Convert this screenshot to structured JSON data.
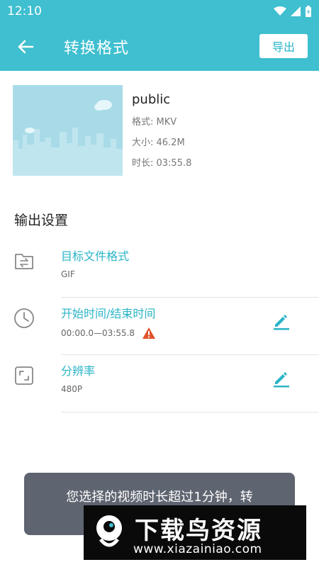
{
  "status_bar": {
    "time": "12:10"
  },
  "app_bar": {
    "title": "转换格式",
    "export_label": "导出"
  },
  "media": {
    "name": "public",
    "format": "格式: MKV",
    "size": "大小: 46.2M",
    "duration": "时长: 03:55.8"
  },
  "output_settings": {
    "title": "输出设置",
    "items": [
      {
        "label": "目标文件格式",
        "value": "GIF"
      },
      {
        "label": "开始时间/结束时间",
        "value": "00:00.0—03:55.8"
      },
      {
        "label": "分辨率",
        "value": "480P"
      }
    ]
  },
  "toast": {
    "message": "您选择的视频时长超过1分钟，转"
  },
  "watermark": {
    "title": "下载鸟资源",
    "url": "www.xiazainiao.com"
  },
  "colors": {
    "primary": "#3fbfd0",
    "accent": "#2ab4c6",
    "warning": "#e0532b",
    "toast_bg": "#5e6470"
  }
}
